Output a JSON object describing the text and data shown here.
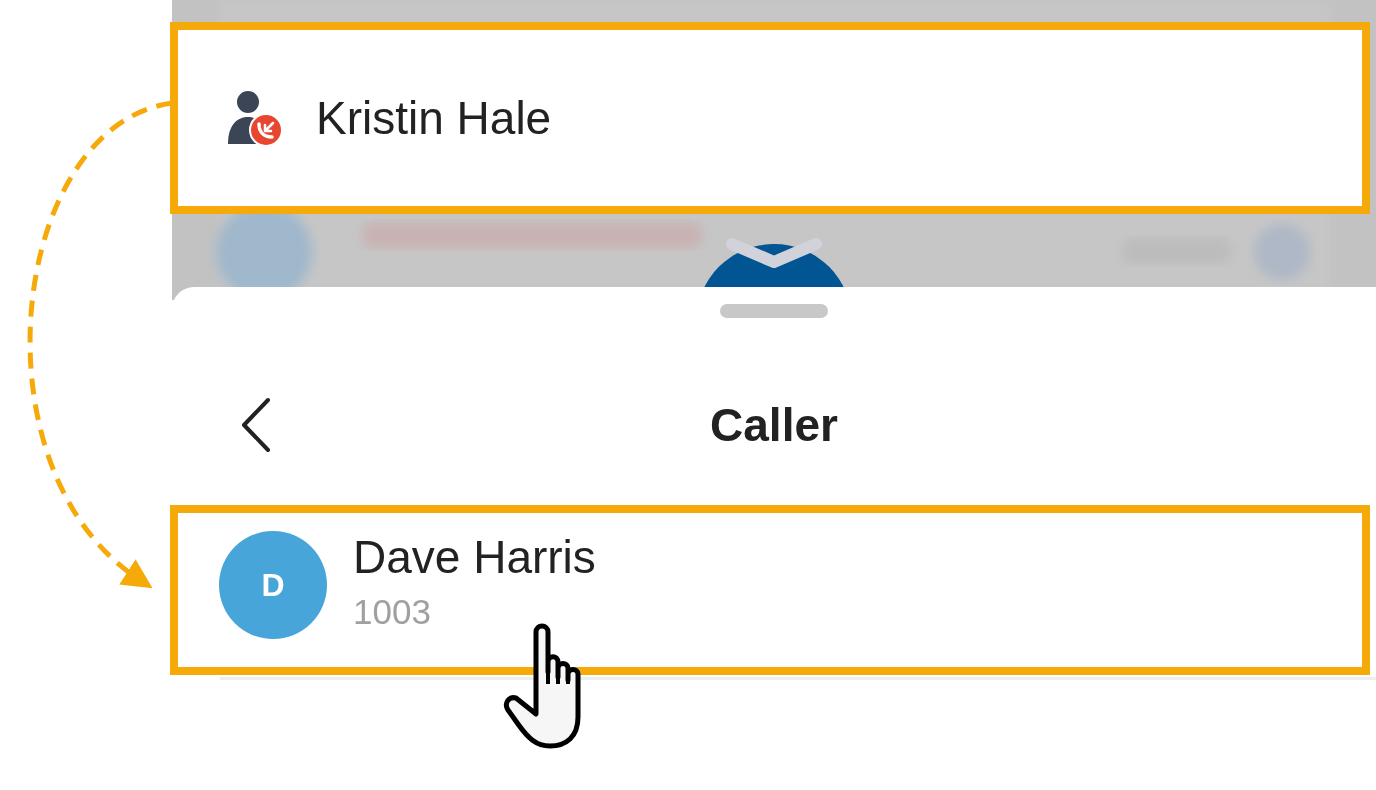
{
  "callout": {
    "name": "Kristin Hale"
  },
  "sheet": {
    "title": "Caller"
  },
  "contacts": [
    {
      "initial": "D",
      "name": "Dave Harris",
      "number": "1003"
    }
  ]
}
